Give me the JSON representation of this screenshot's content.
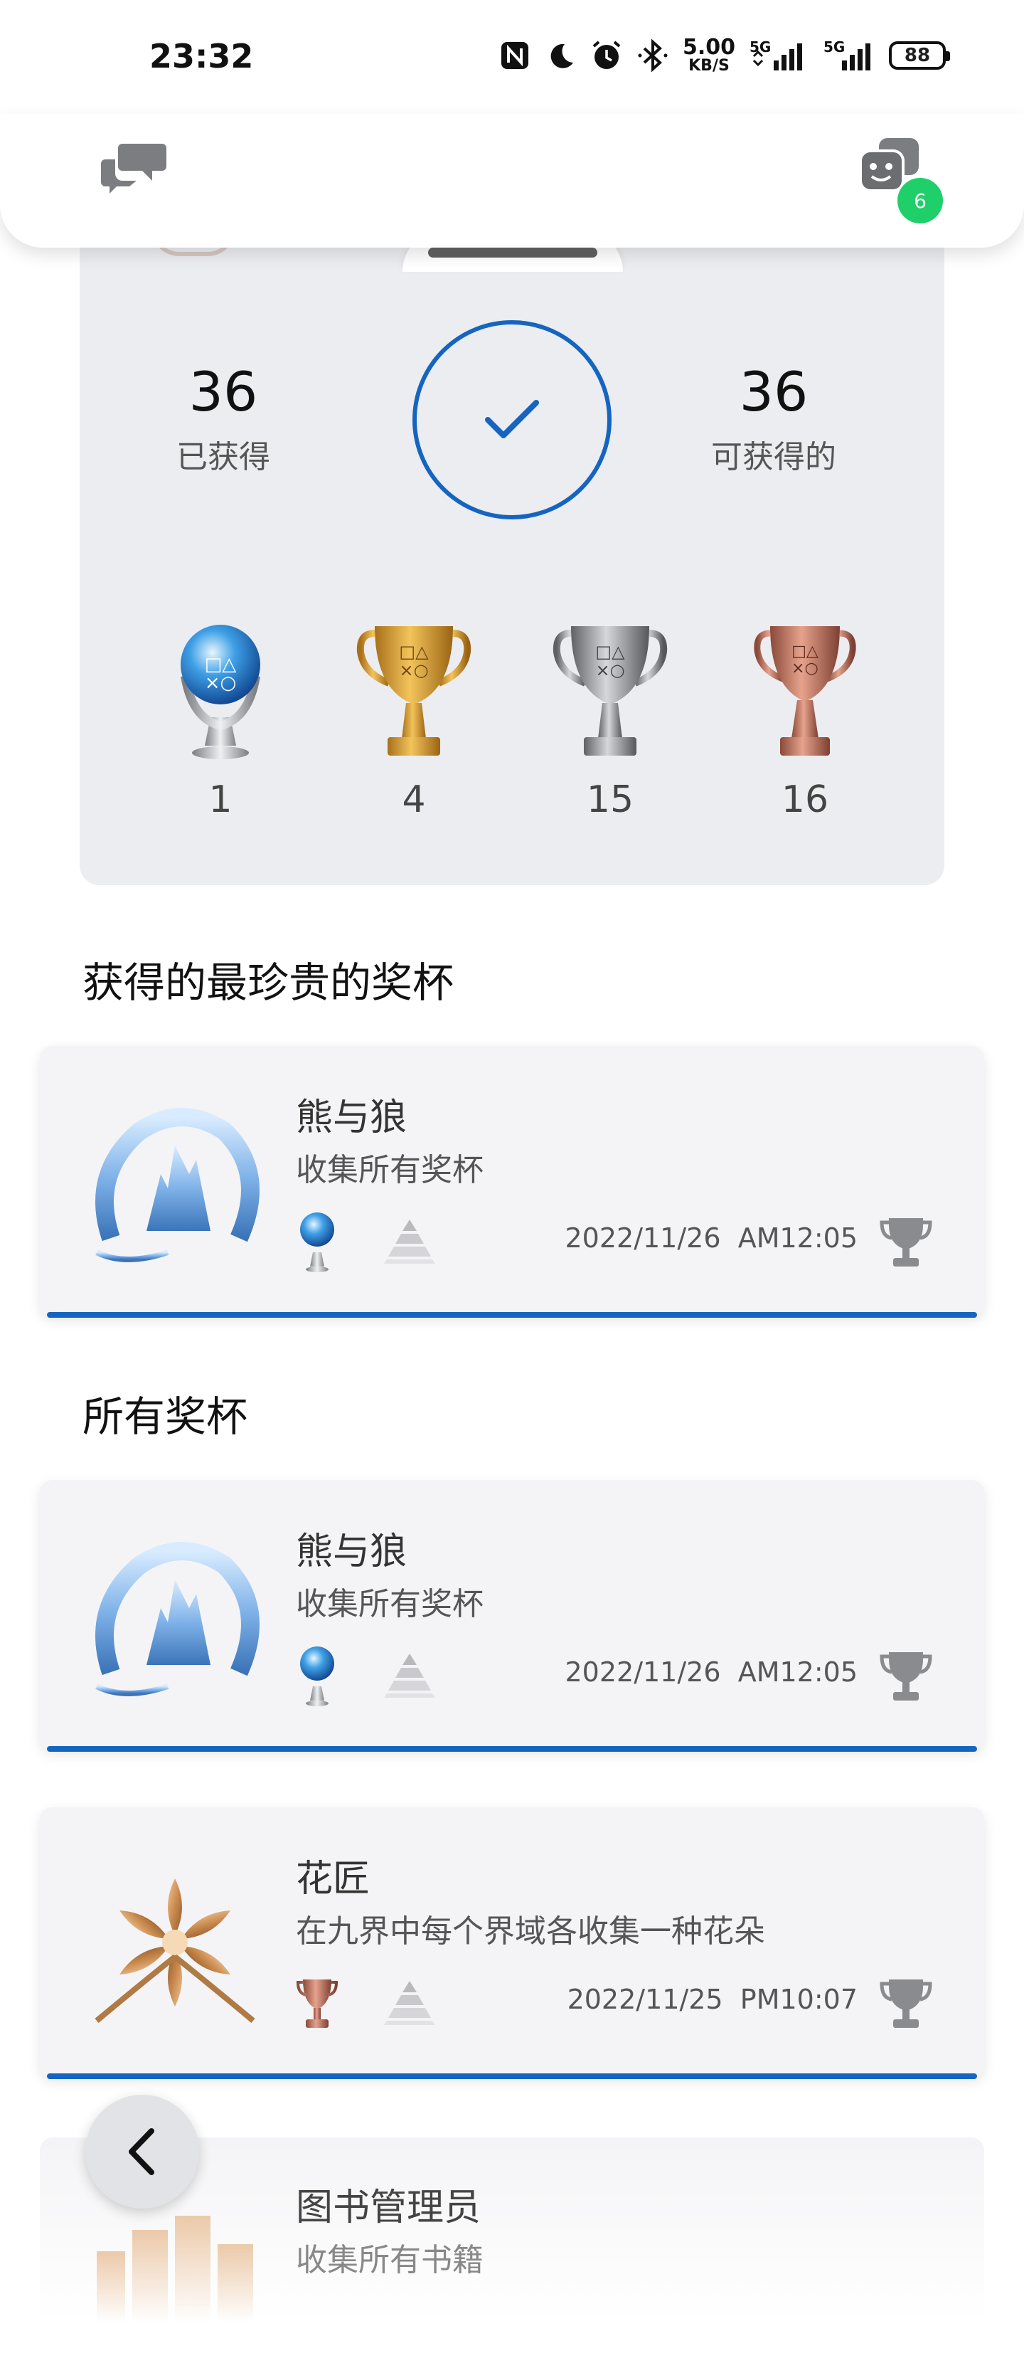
{
  "status_bar": {
    "time": "23:32",
    "net_speed_value": "5.00",
    "net_speed_unit": "KB/S",
    "battery": "88",
    "icons": [
      "nfc-icon",
      "moon-icon",
      "alarm-icon",
      "bluetooth-icon",
      "wifi-5g-icon",
      "signal-icon",
      "signal-5g-icon",
      "battery-icon"
    ]
  },
  "header": {
    "left_icon": "chat-bubbles-icon",
    "right_icon": "friends-icon",
    "badge_count": "6"
  },
  "summary": {
    "earned_count": "36",
    "earned_label": "已获得",
    "available_count": "36",
    "available_label": "可获得的",
    "progress_percent": 100,
    "trophies": [
      {
        "type": "platinum",
        "count": "1"
      },
      {
        "type": "gold",
        "count": "4"
      },
      {
        "type": "silver",
        "count": "15"
      },
      {
        "type": "bronze",
        "count": "16"
      }
    ]
  },
  "rarest": {
    "title": "获得的最珍贵的奖杯",
    "items": [
      {
        "name": "熊与狼",
        "description": "收集所有奖杯",
        "type": "platinum",
        "date": "2022/11/26",
        "time": "AM12:05"
      }
    ]
  },
  "all": {
    "title": "所有奖杯",
    "items": [
      {
        "name": "熊与狼",
        "description": "收集所有奖杯",
        "type": "platinum",
        "date": "2022/11/26",
        "time": "AM12:05"
      },
      {
        "name": "花匠",
        "description": "在九界中每个界域各收集一种花朵",
        "type": "bronze",
        "date": "2022/11/25",
        "time": "PM10:07"
      },
      {
        "name": "图书管理员",
        "description": "收集所有书籍",
        "type": "bronze"
      }
    ]
  },
  "colors": {
    "accent": "#1565c0",
    "badge": "#1fcf6a",
    "card_bg": "#f4f4f6",
    "summary_bg": "#ecedf0"
  }
}
